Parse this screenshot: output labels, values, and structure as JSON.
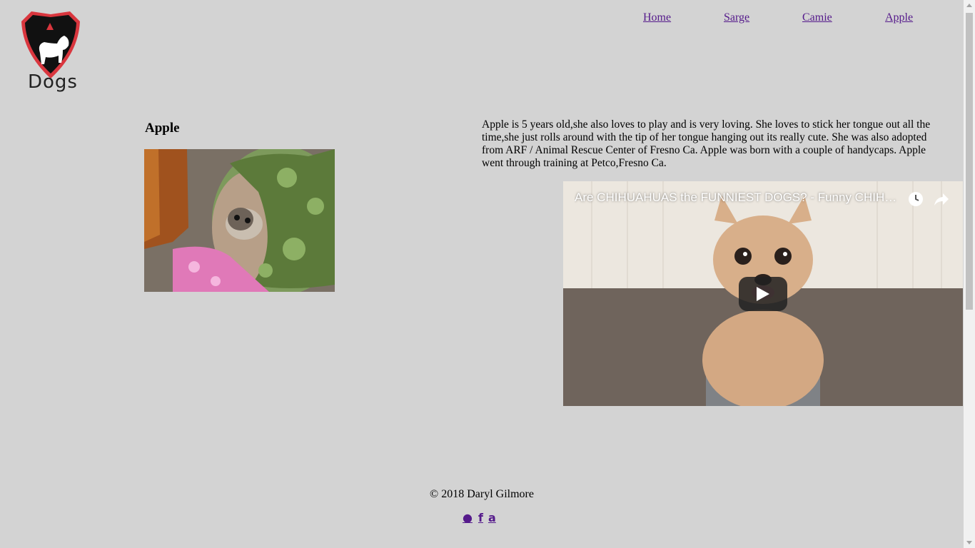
{
  "logo": {
    "text": "Dogs"
  },
  "nav": [
    {
      "label": "Home"
    },
    {
      "label": "Sarge"
    },
    {
      "label": "Camie"
    },
    {
      "label": "Apple"
    }
  ],
  "main": {
    "heading": "Apple",
    "description": "Apple is 5 years old,she also loves to play and is very loving. She loves to stick her tongue out all the time,she just rolls around with the tip of her tongue hanging out its really cute. She was also adopted from ARF / Animal Rescue Center of Fresno Ca. Apple was born with a couple of handycaps. Apple went through training at Petco,Fresno Ca."
  },
  "video": {
    "title": "Are CHIHUAHUAS the FUNNIEST DOGS? - Funny CHIHUAHUA compilation",
    "icons": [
      "watch-later-icon",
      "share-icon",
      "play-icon"
    ]
  },
  "footer": {
    "copyright": "© 2018 Daryl Gilmore",
    "social": [
      {
        "icon": "github-icon",
        "glyph": "●"
      },
      {
        "icon": "facebook-icon",
        "glyph": "f"
      },
      {
        "icon": "amazon-icon",
        "glyph": "a"
      }
    ]
  },
  "colors": {
    "background": "#d3d3d3",
    "link": "#551a8b",
    "logo_red": "#d9363e"
  }
}
